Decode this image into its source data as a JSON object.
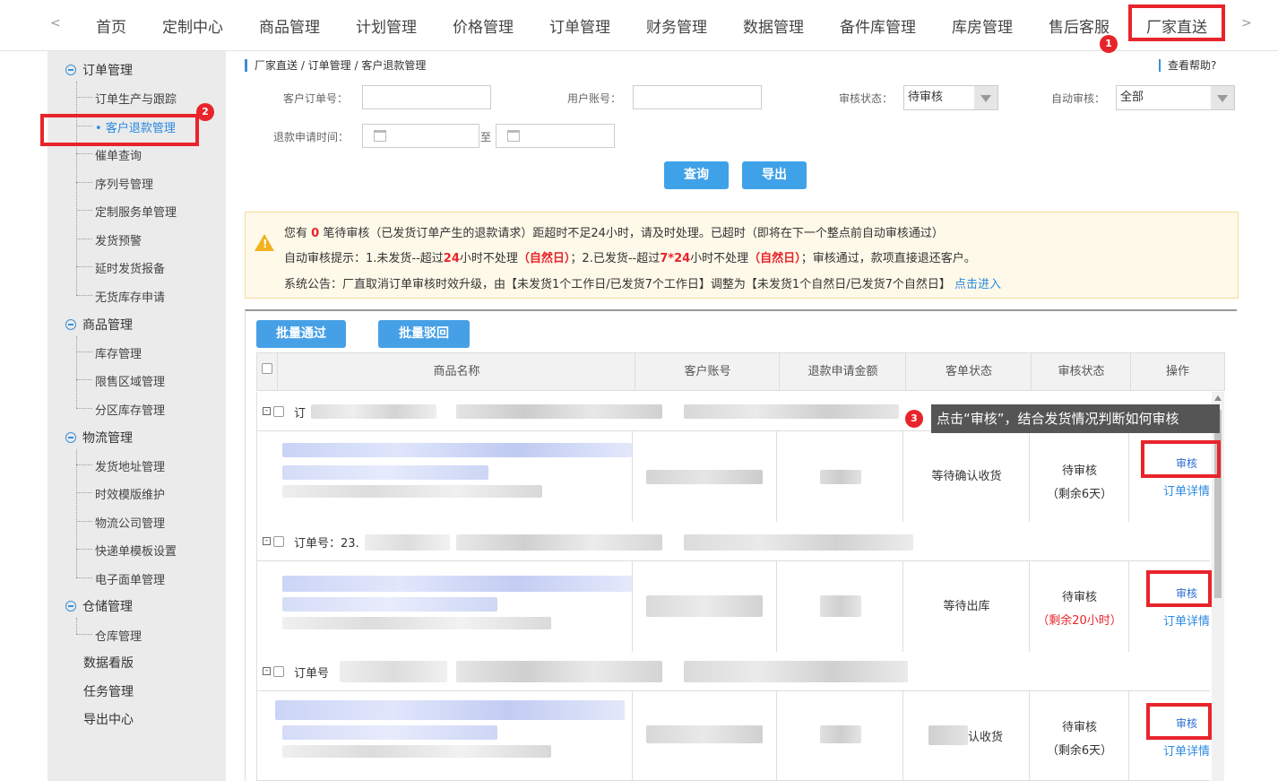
{
  "topnav": {
    "prev": "<",
    "next": ">",
    "items": [
      "首页",
      "定制中心",
      "商品管理",
      "计划管理",
      "价格管理",
      "订单管理",
      "财务管理",
      "数据管理",
      "备件库管理",
      "库房管理",
      "售后客服",
      "厂家直送"
    ]
  },
  "markers": [
    "1",
    "2",
    "3"
  ],
  "sidebar": {
    "groups": [
      "订单管理",
      "商品管理",
      "物流管理",
      "仓储管理"
    ],
    "order_items": [
      "订单生产与跟踪",
      "客户退款管理",
      "催单查询",
      "序列号管理",
      "定制服务单管理",
      "发货预警",
      "延时发货报备",
      "无货库存申请"
    ],
    "goods_items": [
      "库存管理",
      "限售区域管理",
      "分区库存管理"
    ],
    "logistics_items": [
      "发货地址管理",
      "时效模版维护",
      "物流公司管理",
      "快递单模板设置",
      "电子面单管理"
    ],
    "storage_items": [
      "仓库管理"
    ],
    "plain_items": [
      "数据看版",
      "任务管理",
      "导出中心"
    ]
  },
  "breadcrumb": "厂家直送 / 订单管理 / 客户退款管理",
  "help": "查看帮助?",
  "filters": {
    "order_no_label": "客户订单号：",
    "user_label": "用户账号：",
    "audit_label": "审核状态：",
    "audit_value": "待审核",
    "auto_label": "自动审核：",
    "auto_value": "全部",
    "time_label": "退款申请时间：",
    "to": "至"
  },
  "buttons": {
    "query": "查询",
    "export": "导出",
    "batch_pass": "批量通过",
    "batch_reject": "批量驳回"
  },
  "notice": {
    "l1a": "您有 ",
    "l1count": "0",
    "l1b": " 笔待审核（已发货订单产生的退款请求）距超时不足24小时，请及时处理。已超时（即将在下一个整点前自动审核通过）",
    "l2a": "自动审核提示：1.未发货--超过",
    "l2b": "24",
    "l2c": "小时不处理",
    "l2d": "（自然日）",
    "l2e": "；2.已发货--超过",
    "l2f": "7*24",
    "l2g": "小时不处理",
    "l2h": "（自然日）",
    "l2i": "；审核通过，款项直接退还客户。",
    "l3": "系统公告：厂直取消订单审核时效升级，由【未发货1个工作日/已发货7个工作日】调整为【未发货1个自然日/已发货7个自然日】",
    "l3link": "点击进入"
  },
  "table": {
    "headers": [
      "商品名称",
      "客户账号",
      "退款申请金额",
      "客单状态",
      "审核状态",
      "操作"
    ],
    "order_labels": [
      "订",
      "订单号：23.",
      "订单号"
    ],
    "rows": [
      {
        "status": "等待确认收货",
        "audit": "待审核",
        "remain": "（剩余6天）",
        "remain_red": false
      },
      {
        "status": "等待出库",
        "audit": "待审核",
        "remain": "（剩余20小时）",
        "remain_red": true
      },
      {
        "status": "认收货",
        "audit": "待审核",
        "remain": "（剩余6天）",
        "remain_red": false
      }
    ],
    "op_audit": "审核",
    "op_detail": "订单详情"
  },
  "tooltip": "点击“审核”，结合发货情况判断如何审核",
  "colors": {
    "accent": "#3fa2e8",
    "highlight": "#e8242b",
    "warning": "#f0b21e"
  }
}
